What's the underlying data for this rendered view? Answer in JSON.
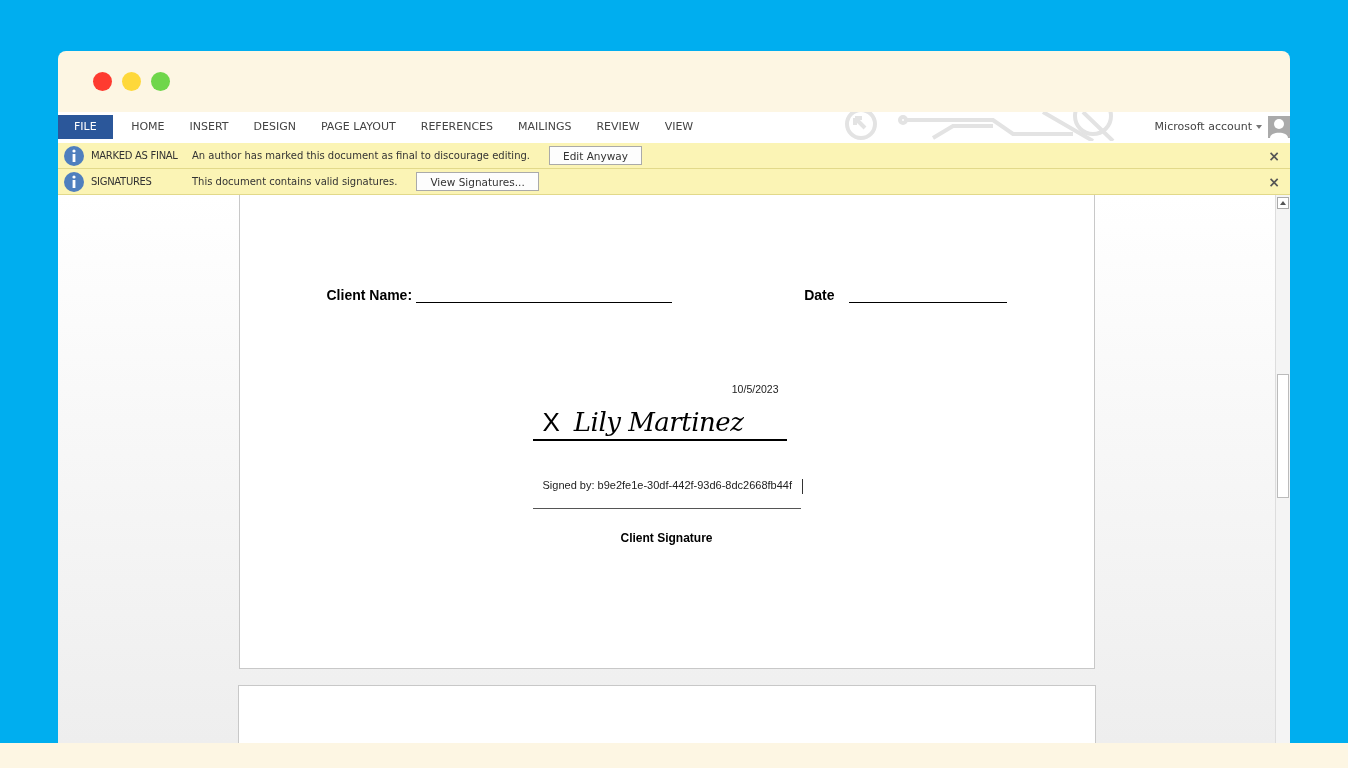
{
  "ribbon": {
    "tabs": [
      {
        "label": "FILE",
        "selected": true
      },
      {
        "label": "HOME",
        "selected": false
      },
      {
        "label": "INSERT",
        "selected": false
      },
      {
        "label": "DESIGN",
        "selected": false
      },
      {
        "label": "PAGE LAYOUT",
        "selected": false
      },
      {
        "label": "REFERENCES",
        "selected": false
      },
      {
        "label": "MAILINGS",
        "selected": false
      },
      {
        "label": "REVIEW",
        "selected": false
      },
      {
        "label": "VIEW",
        "selected": false
      }
    ],
    "account": "Microsoft account"
  },
  "message_bars": [
    {
      "title": "MARKED AS FINAL",
      "message": "An author has marked this document as final to discourage editing.",
      "button": "Edit Anyway",
      "close": "×"
    },
    {
      "title": "SIGNATURES",
      "message": "This document contains valid signatures.",
      "button": "View Signatures...",
      "close": "×"
    }
  ],
  "document": {
    "fields": [
      {
        "label": "Client Name:"
      },
      {
        "label": "Date"
      }
    ],
    "signature": {
      "date": "10/5/2023",
      "mark": "X",
      "name": "Lily Martinez",
      "signed_by": "Signed by: b9e2fe1e-30df-442f-93d6-8dc2668fb44f",
      "caption": "Client Signature"
    }
  }
}
